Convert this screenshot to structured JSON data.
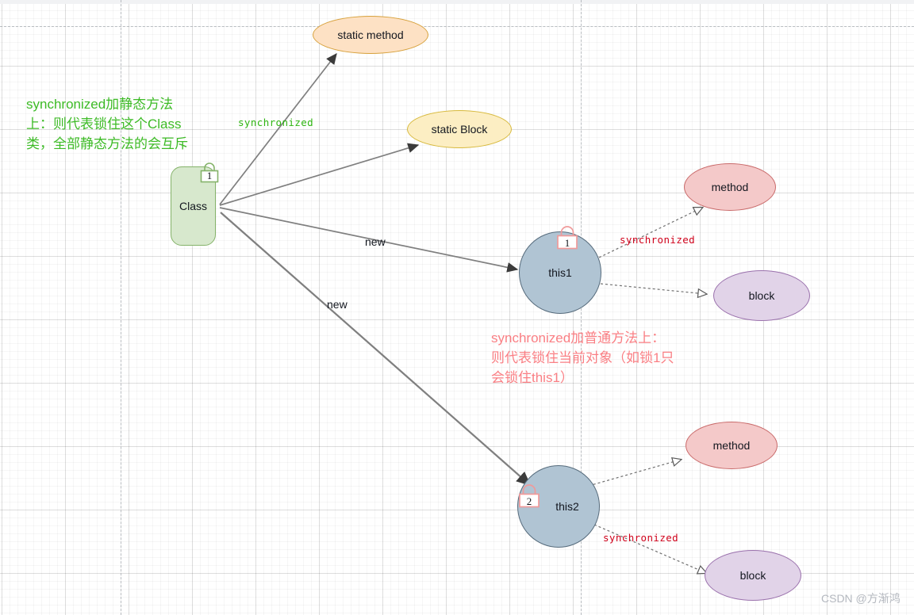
{
  "diagram": {
    "title": "synchronized lock scope diagram",
    "colors": {
      "class_fill": "#d7e8cd",
      "class_stroke": "#85b36a",
      "static_method_fill": "#fde1c4",
      "static_method_stroke": "#d7a13c",
      "static_block_fill": "#fceec3",
      "static_block_stroke": "#d7b93c",
      "this_fill": "#b0c4d3",
      "this_stroke": "#566b7c",
      "method_fill": "#f4c9c9",
      "method_stroke": "#c96a6a",
      "block_fill": "#e1d3e8",
      "block_stroke": "#9b72ad",
      "green_note": "#3dbb26",
      "pink_note": "#fa7f84",
      "green_code": "#2fb612",
      "red_code": "#d0021b",
      "edge_stroke": "#7f7f7f",
      "lock_green": "#85b36a",
      "lock_red": "#f09a9a"
    },
    "nodes": [
      {
        "id": "class",
        "label": "Class",
        "shape": "rounded-rect"
      },
      {
        "id": "static-method",
        "label": "static method",
        "shape": "ellipse"
      },
      {
        "id": "static-block",
        "label": "static Block",
        "shape": "ellipse"
      },
      {
        "id": "this1",
        "label": "this1",
        "shape": "circle"
      },
      {
        "id": "this2",
        "label": "this2",
        "shape": "circle"
      },
      {
        "id": "method1",
        "label": "method",
        "shape": "ellipse"
      },
      {
        "id": "block1",
        "label": "block",
        "shape": "ellipse"
      },
      {
        "id": "method2",
        "label": "method",
        "shape": "ellipse"
      },
      {
        "id": "block2",
        "label": "block",
        "shape": "ellipse"
      }
    ],
    "locks": [
      {
        "id": "lock-class",
        "number": "1",
        "on": "class"
      },
      {
        "id": "lock-this1",
        "number": "1",
        "on": "this1"
      },
      {
        "id": "lock-this2",
        "number": "2",
        "on": "this2"
      }
    ],
    "edge_labels": {
      "synchronized_static": "synchronized",
      "new_this1": "new",
      "new_this2": "new",
      "synchronized_this1": "synchronized",
      "synchronized_this2": "synchronized"
    },
    "notes": {
      "green": "synchronized加静态方法\n上：则代表锁住这个Class\n类，全部静态方法的会互斥",
      "pink": "synchronized加普通方法上：\n则代表锁住当前对象（如锁1只\n会锁住this1）"
    },
    "watermark": "CSDN @方渐鸿"
  }
}
